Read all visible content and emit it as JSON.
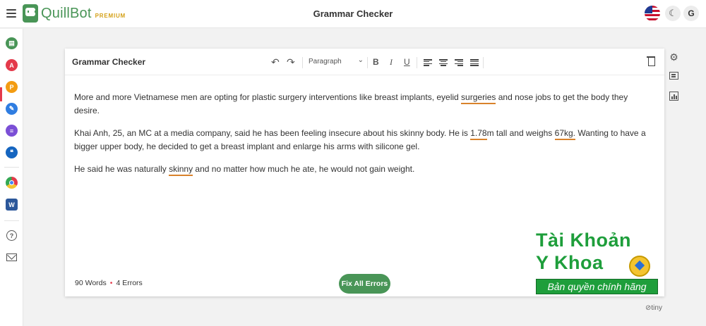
{
  "app": {
    "logo_text": "QuillBot",
    "premium_label": "PREMIUM",
    "page_title": "Grammar Checker",
    "avatar_initial": "G",
    "theme_icon": "moon-icon",
    "language_icon": "us-flag-icon"
  },
  "sidebar": {
    "items": [
      {
        "name": "paraphraser",
        "icon": "paraphraser-icon",
        "color": "#499557"
      },
      {
        "name": "grammar-checker",
        "icon": "grammar-checker-icon",
        "color": "#e43a4b",
        "active": true
      },
      {
        "name": "plagiarism-checker",
        "icon": "plagiarism-checker-icon",
        "color": "#f39c12"
      },
      {
        "name": "co-writer",
        "icon": "co-writer-icon",
        "color": "#2f7de1"
      },
      {
        "name": "summarizer",
        "icon": "summarizer-icon",
        "color": "#7b4fd6"
      },
      {
        "name": "citation-generator",
        "icon": "citation-icon",
        "color": "#1565c0"
      },
      {
        "name": "chrome-extension",
        "icon": "chrome-icon"
      },
      {
        "name": "word-addin",
        "icon": "word-icon",
        "color": "#2b579a"
      },
      {
        "name": "help",
        "icon": "help-icon",
        "glyph": "?"
      },
      {
        "name": "contact",
        "icon": "mail-icon"
      }
    ]
  },
  "editor": {
    "title": "Grammar Checker",
    "paragraph_select": "Paragraph",
    "toolbar": {
      "undo": "↶",
      "redo": "↷",
      "bold": "B",
      "italic": "I",
      "underline": "U"
    },
    "paragraphs": [
      {
        "before": "More and more Vietnamese men are opting for plastic surgery interventions like breast implants, eyelid ",
        "err1": "surgeries",
        "after": " and nose jobs to get the body they desire."
      },
      {
        "before": "Khai Anh, 25, an MC at a media company, said he has been feeling insecure about his skinny body. He is ",
        "err1": "1.78",
        "mid": "m tall and weighs ",
        "err2": "67kg.",
        "after": " Wanting to have a bigger upper body, he decided to get a breast implant and enlarge his arms with silicone gel."
      },
      {
        "before": "He said he was naturally ",
        "err1": "skinny",
        "after": " and no matter how much he ate, he would not gain weight."
      }
    ],
    "word_count": "90 Words",
    "error_count": "4 Errors",
    "fix_button": "Fix All Errors"
  },
  "right_rail": {
    "settings_icon": "gear-icon",
    "comments_icon": "comments-icon",
    "stats_icon": "statistics-icon"
  },
  "footer": {
    "tiny_label": "tiny"
  },
  "watermark": {
    "line1": "Tài Khoản",
    "line2": "Y Khoa",
    "banner": "Bản quyền chính hãng"
  },
  "colors": {
    "brand": "#499557",
    "error_underline": "#d9822b",
    "active_accent": "#e43a4b"
  }
}
